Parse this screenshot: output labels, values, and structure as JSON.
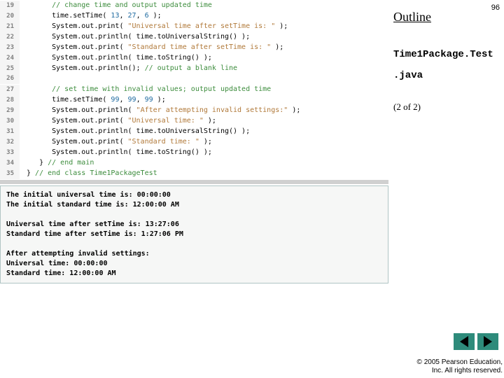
{
  "sidebar": {
    "page_num": "96",
    "outline": "Outline",
    "file_line1": "Time1Package.Test",
    "file_line2": ".java",
    "pager": "(2 of 2)"
  },
  "code": {
    "lines": [
      {
        "n": "19",
        "indent": "      ",
        "tokens": [
          [
            "comment",
            "// change time and output updated time"
          ]
        ]
      },
      {
        "n": "20",
        "indent": "      ",
        "tokens": [
          [
            "default",
            "time.setTime( "
          ],
          [
            "number",
            "13"
          ],
          [
            "default",
            ", "
          ],
          [
            "number",
            "27"
          ],
          [
            "default",
            ", "
          ],
          [
            "number",
            "6"
          ],
          [
            "default",
            " );"
          ]
        ]
      },
      {
        "n": "21",
        "indent": "      ",
        "tokens": [
          [
            "default",
            "System.out.print( "
          ],
          [
            "string",
            "\"Universal time after setTime is: \""
          ],
          [
            "default",
            " );"
          ]
        ]
      },
      {
        "n": "22",
        "indent": "      ",
        "tokens": [
          [
            "default",
            "System.out.println( time.toUniversalString() );"
          ]
        ]
      },
      {
        "n": "23",
        "indent": "      ",
        "tokens": [
          [
            "default",
            "System.out.print( "
          ],
          [
            "string",
            "\"Standard time after setTime is: \""
          ],
          [
            "default",
            " );"
          ]
        ]
      },
      {
        "n": "24",
        "indent": "      ",
        "tokens": [
          [
            "default",
            "System.out.println( time.toString() );"
          ]
        ]
      },
      {
        "n": "25",
        "indent": "      ",
        "tokens": [
          [
            "default",
            "System.out.println(); "
          ],
          [
            "comment",
            "// output a blank line"
          ]
        ]
      },
      {
        "n": "26",
        "indent": "",
        "tokens": []
      },
      {
        "n": "27",
        "indent": "      ",
        "tokens": [
          [
            "comment",
            "// set time with invalid values; output updated time"
          ]
        ]
      },
      {
        "n": "28",
        "indent": "      ",
        "tokens": [
          [
            "default",
            "time.setTime( "
          ],
          [
            "number",
            "99"
          ],
          [
            "default",
            ", "
          ],
          [
            "number",
            "99"
          ],
          [
            "default",
            ", "
          ],
          [
            "number",
            "99"
          ],
          [
            "default",
            " );"
          ]
        ]
      },
      {
        "n": "29",
        "indent": "      ",
        "tokens": [
          [
            "default",
            "System.out.println( "
          ],
          [
            "string",
            "\"After attempting invalid settings:\""
          ],
          [
            "default",
            " );"
          ]
        ]
      },
      {
        "n": "30",
        "indent": "      ",
        "tokens": [
          [
            "default",
            "System.out.print( "
          ],
          [
            "string",
            "\"Universal time: \""
          ],
          [
            "default",
            " );"
          ]
        ]
      },
      {
        "n": "31",
        "indent": "      ",
        "tokens": [
          [
            "default",
            "System.out.println( time.toUniversalString() );"
          ]
        ]
      },
      {
        "n": "32",
        "indent": "      ",
        "tokens": [
          [
            "default",
            "System.out.print( "
          ],
          [
            "string",
            "\"Standard time: \""
          ],
          [
            "default",
            " );"
          ]
        ]
      },
      {
        "n": "33",
        "indent": "      ",
        "tokens": [
          [
            "default",
            "System.out.println( time.toString() );"
          ]
        ]
      },
      {
        "n": "34",
        "indent": "   ",
        "tokens": [
          [
            "default",
            "} "
          ],
          [
            "comment",
            "// end main"
          ]
        ]
      },
      {
        "n": "35",
        "indent": "",
        "tokens": [
          [
            "default",
            "} "
          ],
          [
            "comment",
            "// end class Time1PackageTest"
          ]
        ]
      }
    ]
  },
  "output": "The initial universal time is: 00:00:00\nThe initial standard time is: 12:00:00 AM\n\nUniversal time after setTime is: 13:27:06\nStandard time after setTime is: 1:27:06 PM\n\nAfter attempting invalid settings:\nUniversal time: 00:00:00\nStandard time: 12:00:00 AM",
  "footer": {
    "copy1": "© 2005 Pearson Education,",
    "copy2": "Inc.  All rights reserved."
  }
}
